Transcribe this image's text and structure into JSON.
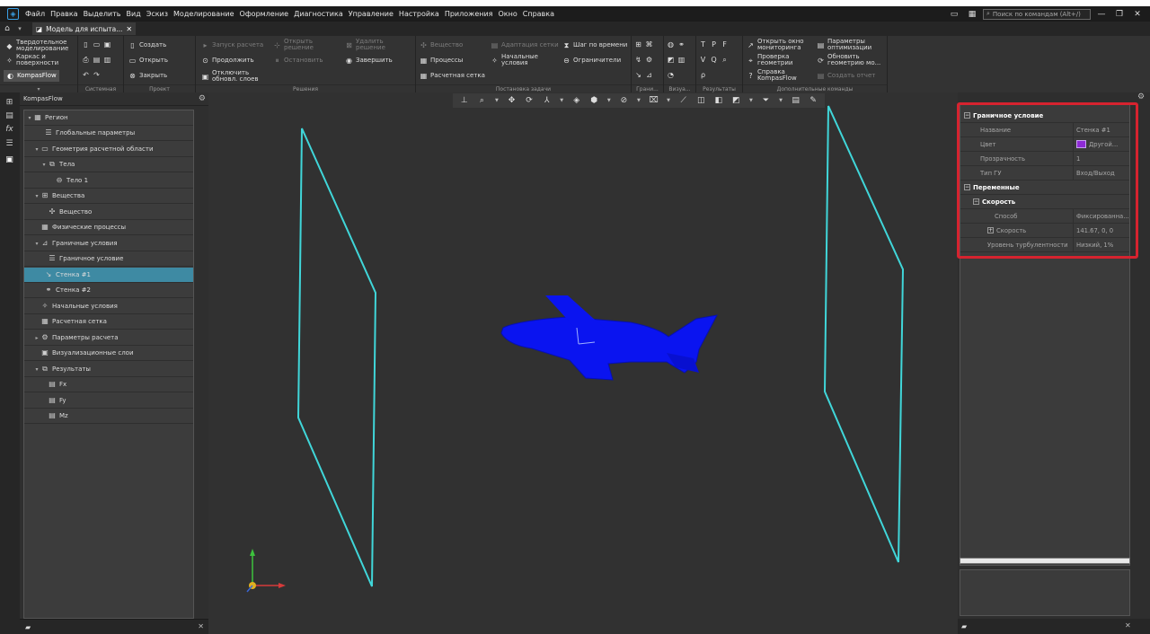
{
  "app": {
    "menu": [
      "Файл",
      "Правка",
      "Выделить",
      "Вид",
      "Эскиз",
      "Моделирование",
      "Оформление",
      "Диагностика",
      "Управление",
      "Настройка",
      "Приложения",
      "Окно",
      "Справка"
    ],
    "search_placeholder": "Поиск по командам (Alt+/)",
    "doc_tab": "Модель для испыта..."
  },
  "ribbon": {
    "modes": [
      "Твердотельное моделирование",
      "Каркас и поверхности",
      "KompasFlow"
    ],
    "groups": {
      "system": "Системная",
      "project": "Проект",
      "solution": "Решения",
      "setup": "Постановка задачи",
      "bounds": "Грани...",
      "vis": "Визуа...",
      "results": "Результаты",
      "extra": "Дополнительные команды"
    },
    "buttons": {
      "create": "Создать",
      "open": "Открыть",
      "close": "Закрыть",
      "run": "Запуск расчета",
      "continue": "Продолжить",
      "disable_line1": "Отключить",
      "disable_line2": "обновл. слоев",
      "open_sol_line1": "Открыть",
      "open_sol_line2": "решение",
      "stop": "Остановить",
      "delete_sol_line1": "Удалить",
      "delete_sol_line2": "решение",
      "finish": "Завершить",
      "substance": "Вещество",
      "processes": "Процессы",
      "mesh": "Расчетная сетка",
      "mesh_adapt": "Адаптация сетки",
      "init_line1": "Начальные",
      "init_line2": "условия",
      "time_step": "Шаг по времени",
      "limiters": "Ограничители",
      "monitor_line1": "Открыть окно",
      "monitor_line2": "мониторинга",
      "check_line1": "Проверка",
      "check_line2": "геометрии",
      "help_line1": "Справка",
      "help_line2": "KompasFlow",
      "optparams_line1": "Параметры",
      "optparams_line2": "оптимизации",
      "refresh_line1": "Обновить",
      "refresh_line2": "геометрию мо...",
      "report": "Создать отчет"
    }
  },
  "tree": {
    "panel_title": "KompasFlow",
    "items": [
      {
        "label": "Регион"
      },
      {
        "label": "Глобальные параметры"
      },
      {
        "label": "Геометрия расчетной области"
      },
      {
        "label": "Тела"
      },
      {
        "label": "Тело 1"
      },
      {
        "label": "Вещества"
      },
      {
        "label": "Вещество"
      },
      {
        "label": "Физические процессы"
      },
      {
        "label": "Граничные условия"
      },
      {
        "label": "Граничное условие"
      },
      {
        "label": "Стенка #1"
      },
      {
        "label": "Стенка #2"
      },
      {
        "label": "Начальные условия"
      },
      {
        "label": "Расчетная сетка"
      },
      {
        "label": "Параметры расчета"
      },
      {
        "label": "Визуализационные слои"
      },
      {
        "label": "Результаты"
      },
      {
        "label": "Fx"
      },
      {
        "label": "Fy"
      },
      {
        "label": "Mz"
      }
    ]
  },
  "props": {
    "section_bc": "Граничное условие",
    "name_key": "Название",
    "name_val": "Стенка #1",
    "color_key": "Цвет",
    "color_val": "Другой...",
    "color_hex": "#8e2ad6",
    "transp_key": "Прозрачность",
    "transp_val": "1",
    "type_key": "Тип ГУ",
    "type_val": "Вход/Выход",
    "section_vars": "Переменные",
    "section_speed": "Скорость",
    "method_key": "Способ",
    "method_val": "Фиксированна...",
    "speed_key": "Скорость",
    "speed_val": "141.67, 0, 0",
    "turb_key": "Уровень турбулентности",
    "turb_val": "Низкий, 1%"
  },
  "colors": {
    "accent": "#3aa0e6",
    "selection": "#3e8aa3",
    "highlight": "#d6232f",
    "plane_outline": "#40d6d9",
    "aircraft": "#0a14f0"
  }
}
